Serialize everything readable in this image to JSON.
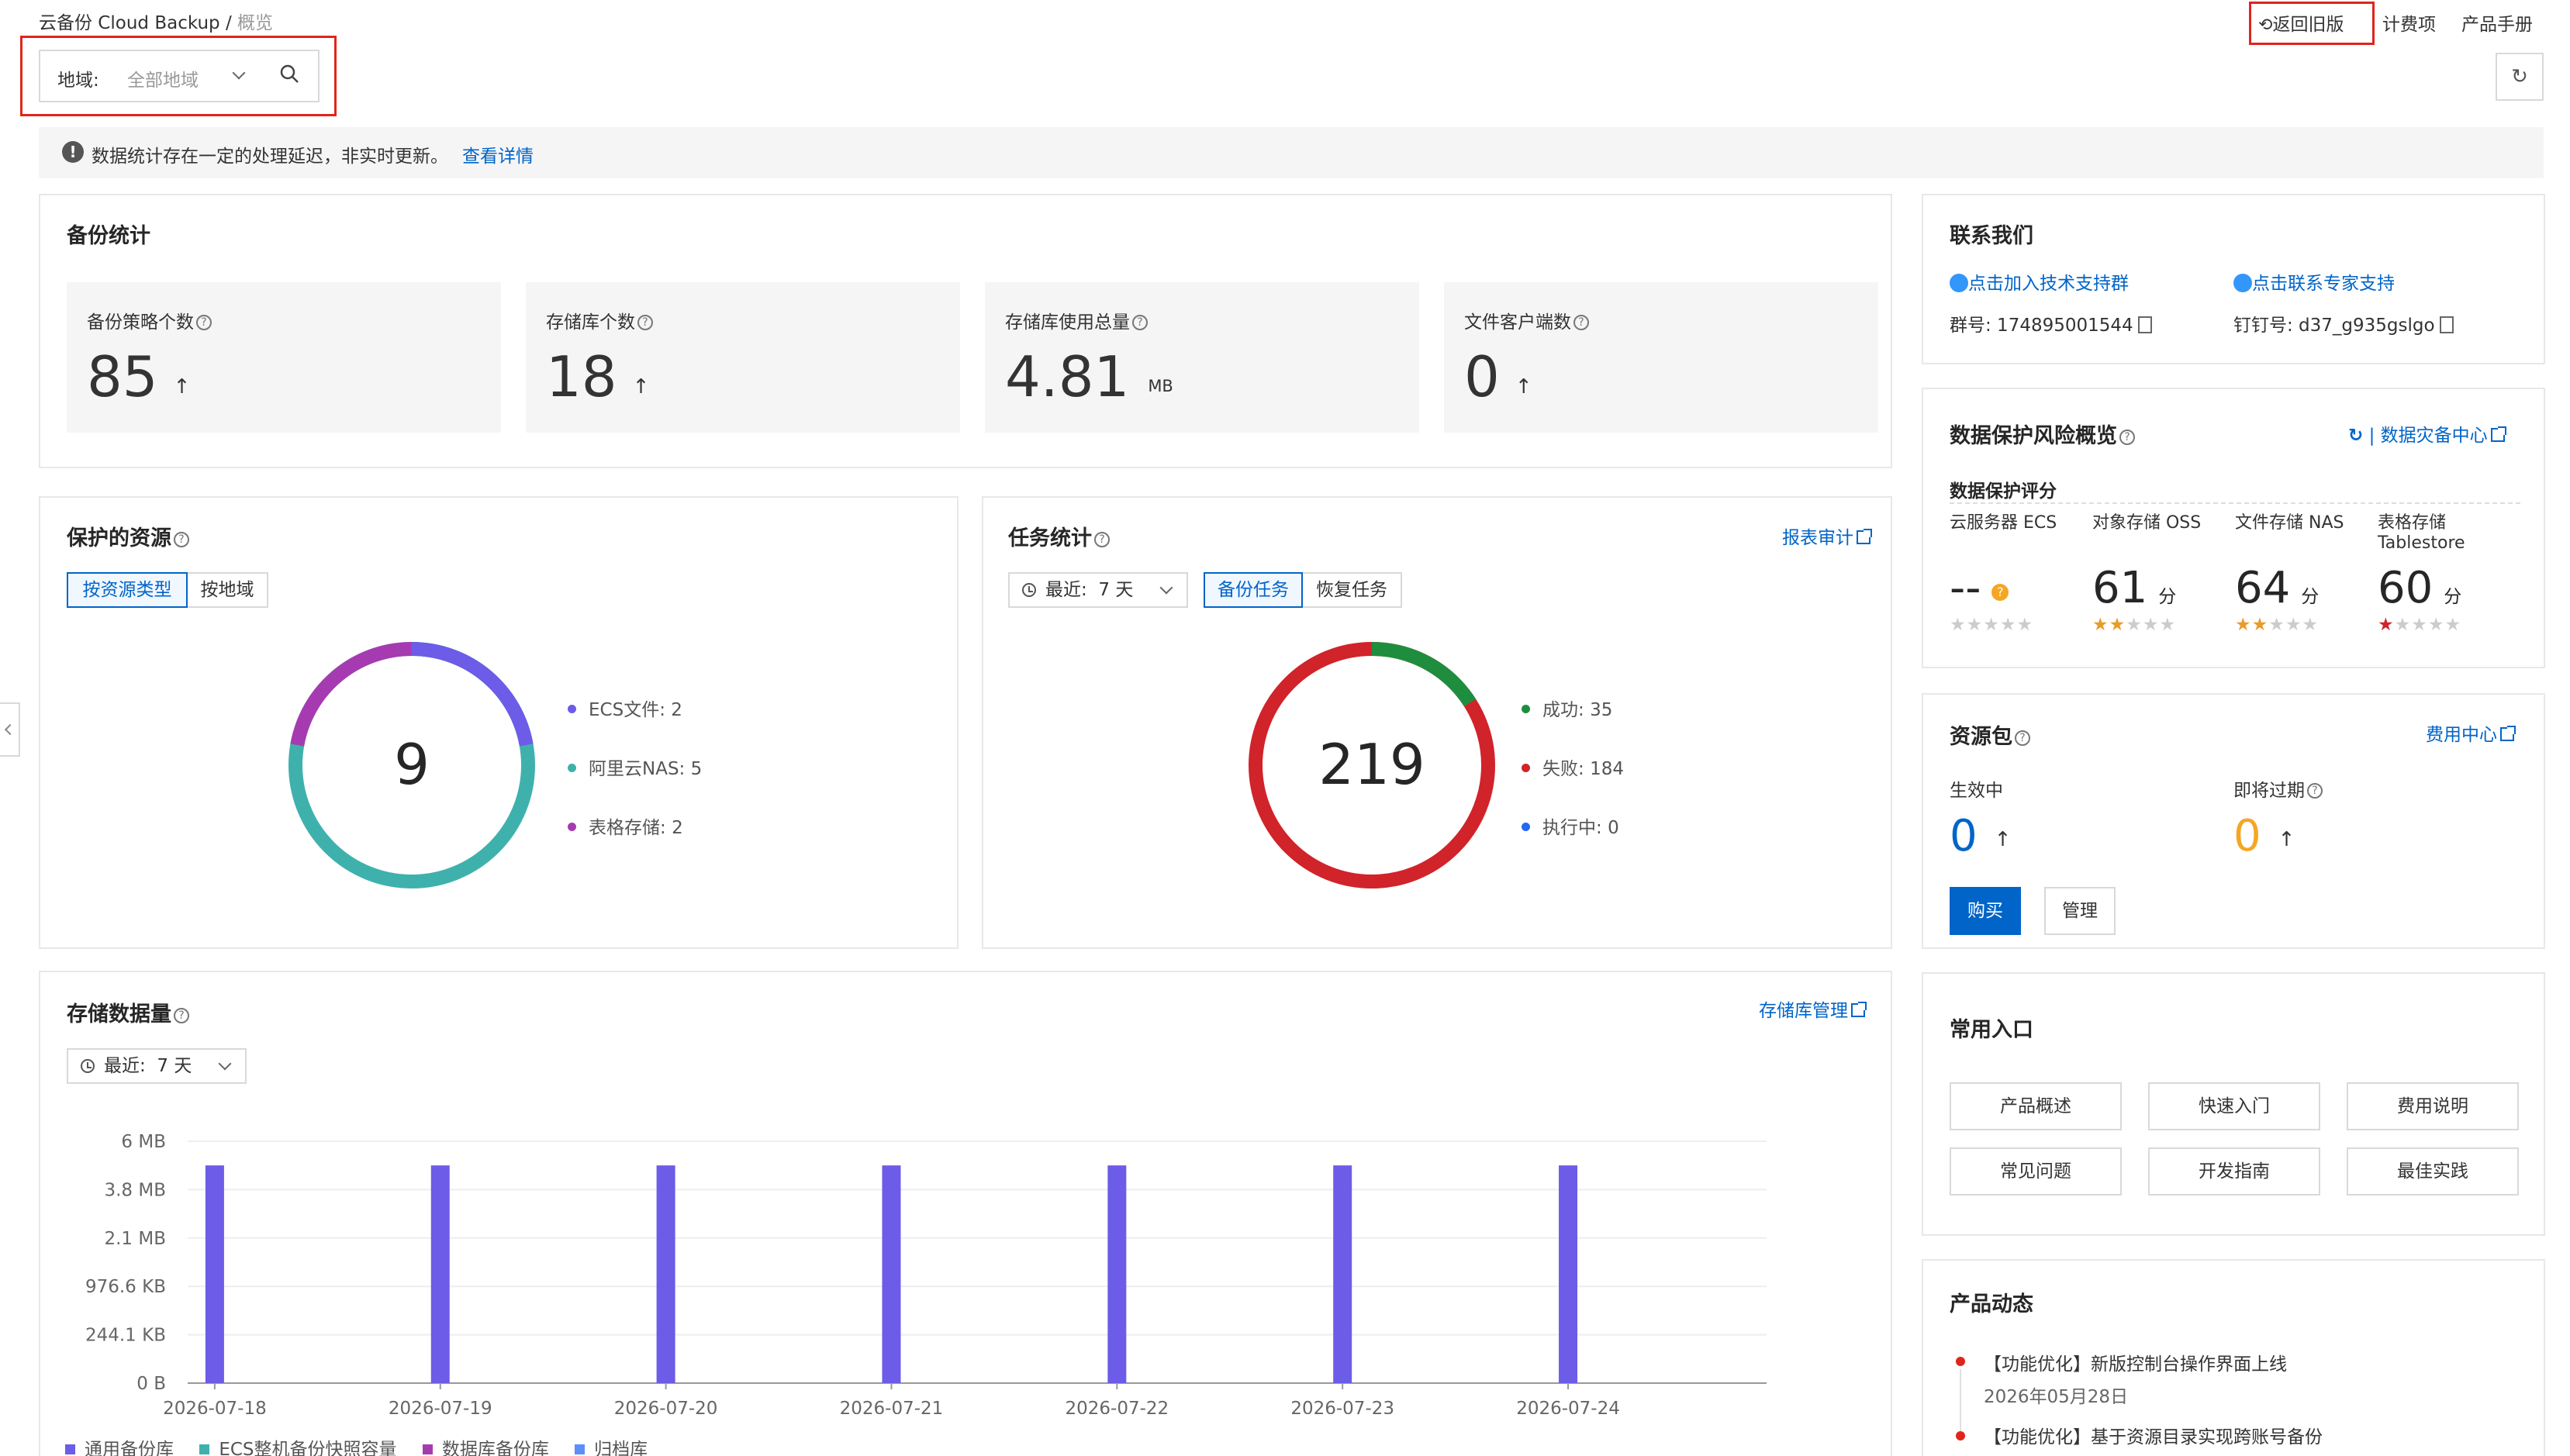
{
  "breadcrumb": {
    "product": "云备份 Cloud Backup",
    "separator": "/",
    "current": "概览"
  },
  "header": {
    "return_old": "返回旧版",
    "billing": "计费项",
    "manual": "产品手册"
  },
  "region_filter": {
    "label": "地域:",
    "value": "全部地域"
  },
  "notice": {
    "text": "数据统计存在一定的处理延迟，非实时更新。",
    "link": "查看详情"
  },
  "backup_stats": {
    "title": "备份统计",
    "items": [
      {
        "label": "备份策略个数",
        "value": "85",
        "arrow": "↑"
      },
      {
        "label": "存储库个数",
        "value": "18",
        "arrow": "↑"
      },
      {
        "label": "存储库使用总量",
        "value": "4.81",
        "unit": "MB"
      },
      {
        "label": "文件客户端数",
        "value": "0",
        "arrow": "↑"
      }
    ]
  },
  "protected": {
    "title": "保护的资源",
    "tabs": [
      "按资源类型",
      "按地域"
    ],
    "total": "9",
    "legend": [
      {
        "label": "ECS文件:",
        "value": "2",
        "color": "#6c5ce7"
      },
      {
        "label": "阿里云NAS:",
        "value": "5",
        "color": "#3fb1ad"
      },
      {
        "label": "表格存储:",
        "value": "2",
        "color": "#a63bb1"
      }
    ]
  },
  "tasks": {
    "title": "任务统计",
    "report_link": "报表审计",
    "range_label": "最近:",
    "range_value": "7 天",
    "tabs": [
      "备份任务",
      "恢复任务"
    ],
    "total": "219",
    "legend": [
      {
        "label": "成功:",
        "value": "35",
        "color": "#1e8e3e"
      },
      {
        "label": "失败:",
        "value": "184",
        "color": "#d1232a"
      },
      {
        "label": "执行中:",
        "value": "0",
        "color": "#2468f2"
      }
    ]
  },
  "storage": {
    "title": "存储数据量",
    "link": "存储库管理",
    "range_label": "最近:",
    "range_value": "7 天"
  },
  "chart_data": {
    "type": "bar",
    "categories": [
      "2026-07-18",
      "2026-07-19",
      "2026-07-20",
      "2026-07-21",
      "2026-07-22",
      "2026-07-23",
      "2026-07-24"
    ],
    "y_ticks": [
      "0 B",
      "244.1 KB",
      "976.6 KB",
      "2.1 MB",
      "3.8 MB",
      "6 MB"
    ],
    "series": [
      {
        "name": "通用备份库",
        "color": "#6c5ce7",
        "values": [
          4.81,
          4.81,
          4.81,
          4.81,
          4.81,
          4.81,
          4.81
        ]
      },
      {
        "name": "ECS整机备份快照容量",
        "color": "#3fb1ad",
        "values": [
          0,
          0,
          0,
          0,
          0,
          0,
          0
        ]
      },
      {
        "name": "数据库备份库",
        "color": "#a63bb1",
        "values": [
          0,
          0,
          0,
          0,
          0,
          0,
          0
        ]
      },
      {
        "name": "归档库",
        "color": "#5b8ff9",
        "values": [
          0,
          0,
          0,
          0,
          0,
          0,
          0
        ]
      }
    ],
    "value_unit": "MB",
    "grid": true,
    "legend_position": "bottom-left"
  },
  "contact": {
    "title": "联系我们",
    "join_group": "点击加入技术支持群",
    "expert": "点击联系专家支持",
    "group_no": "群号: 174895001544",
    "dingtalk": "钉钉号: d37_g935gslgo"
  },
  "risk": {
    "title": "数据保护风险概览",
    "link": "数据灾备中心",
    "score_label": "数据保护评分",
    "items": [
      {
        "name": "云服务器 ECS",
        "score": "--",
        "unit": "",
        "stars": 0
      },
      {
        "name": "对象存储 OSS",
        "score": "61",
        "unit": "分",
        "stars": 2
      },
      {
        "name": "文件存储 NAS",
        "score": "64",
        "unit": "分",
        "stars": 2
      },
      {
        "name": "表格存储\nTablestore",
        "score": "60",
        "unit": "分",
        "stars": 1
      }
    ]
  },
  "resource_pkg": {
    "title": "资源包",
    "link": "费用中心",
    "active_label": "生效中",
    "active_value": "0",
    "expiring_label": "即将过期",
    "expiring_value": "0",
    "arrow": "↑",
    "buy": "购买",
    "manage": "管理"
  },
  "shortcuts": {
    "title": "常用入口",
    "items": [
      "产品概述",
      "快速入门",
      "费用说明",
      "常见问题",
      "开发指南",
      "最佳实践"
    ]
  },
  "news": {
    "title": "产品动态",
    "items": [
      {
        "text": "【功能优化】新版控制台操作界面上线",
        "date": "2026年05月28日"
      },
      {
        "text": "【功能优化】基于资源目录实现跨账号备份",
        "date": ""
      }
    ]
  },
  "colors": {
    "accent": "#0064c8",
    "highlight_border": "#e0251c"
  }
}
